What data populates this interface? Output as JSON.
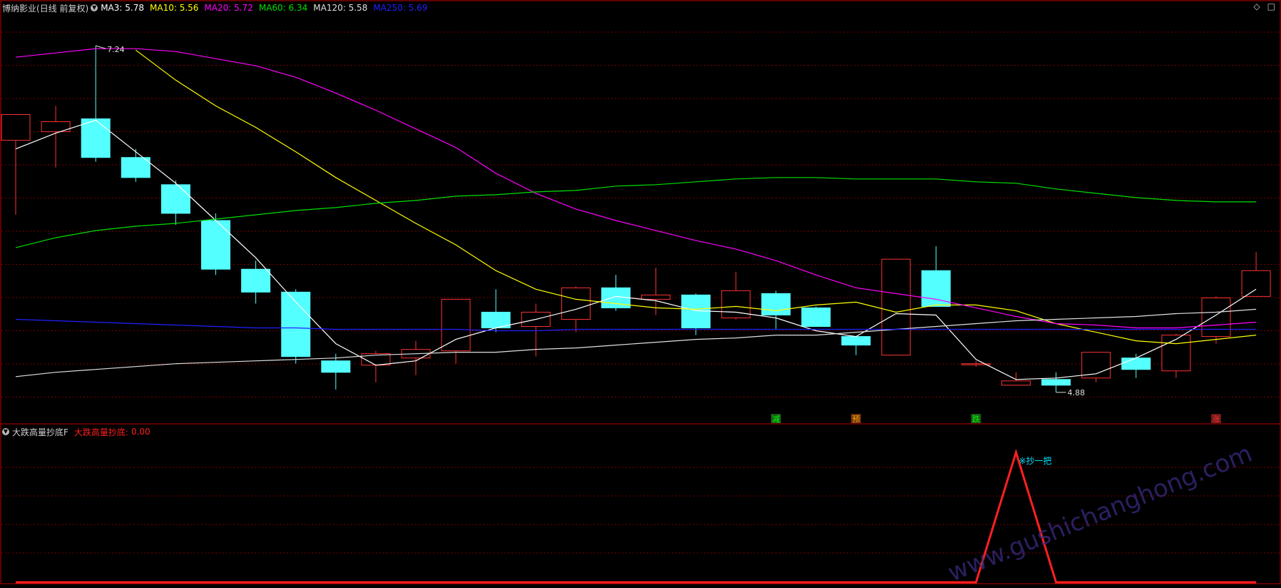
{
  "main_panel": {
    "stock_name": "博纳影业",
    "period_info": "(日线 前复权)",
    "ma_legend": [
      {
        "label": "MA3:",
        "value": "5.78",
        "color": "#ffffff"
      },
      {
        "label": "MA10:",
        "value": "5.56",
        "color": "#ffff00"
      },
      {
        "label": "MA20:",
        "value": "5.72",
        "color": "#ff00ff"
      },
      {
        "label": "MA60:",
        "value": "6.34",
        "color": "#00e000"
      },
      {
        "label": "MA120:",
        "value": "5.58",
        "color": "#e0e0e0"
      },
      {
        "label": "MA250:",
        "value": "5.69",
        "color": "#2020ff"
      }
    ],
    "high_label": "7.24",
    "low_label": "4.88",
    "signals": [
      {
        "index": 19,
        "text": "减",
        "color": "#00ff00",
        "bg": "#1a5a1a"
      },
      {
        "index": 21,
        "text": "预",
        "color": "#ffaa00",
        "bg": "#6a3010"
      },
      {
        "index": 24,
        "text": "跌",
        "color": "#00ff00",
        "bg": "#1a5a1a"
      },
      {
        "index": 30,
        "text": "涨",
        "color": "#ff3030",
        "bg": "#6a1a1a"
      }
    ]
  },
  "sub_panel": {
    "indicator_name": "大跌高量抄底F",
    "series_label": "大跌高量抄底:",
    "series_value": "0.00",
    "annotation": "※抄一把",
    "colors": {
      "line": "#ff2020",
      "label": "#ff2020",
      "annotation": "#00e5ff"
    }
  },
  "watermark": "www.gushichanghong.com",
  "colors": {
    "up": "#ff3232",
    "down": "#54ffff",
    "grid": "#7a0000",
    "border": "#c00000"
  },
  "chart_data": [
    {
      "type": "candlestick",
      "ylim": [
        4.6,
        7.45
      ],
      "candles": [
        {
          "o": 6.58,
          "h": 6.66,
          "l": 6.06,
          "c": 6.76
        },
        {
          "o": 6.64,
          "h": 6.82,
          "l": 6.39,
          "c": 6.71
        },
        {
          "o": 6.73,
          "h": 7.24,
          "l": 6.43,
          "c": 6.46
        },
        {
          "o": 6.46,
          "h": 6.52,
          "l": 6.29,
          "c": 6.32
        },
        {
          "o": 6.27,
          "h": 6.3,
          "l": 5.99,
          "c": 6.07
        },
        {
          "o": 6.02,
          "h": 6.07,
          "l": 5.64,
          "c": 5.68
        },
        {
          "o": 5.68,
          "h": 5.74,
          "l": 5.44,
          "c": 5.52
        },
        {
          "o": 5.52,
          "h": 5.54,
          "l": 5.02,
          "c": 5.07
        },
        {
          "o": 5.04,
          "h": 5.09,
          "l": 4.84,
          "c": 4.96
        },
        {
          "o": 5.01,
          "h": 5.11,
          "l": 4.89,
          "c": 5.09
        },
        {
          "o": 5.06,
          "h": 5.18,
          "l": 4.94,
          "c": 5.12
        },
        {
          "o": 5.11,
          "h": 5.47,
          "l": 5.02,
          "c": 5.47
        },
        {
          "o": 5.38,
          "h": 5.54,
          "l": 5.24,
          "c": 5.27
        },
        {
          "o": 5.28,
          "h": 5.44,
          "l": 5.07,
          "c": 5.38
        },
        {
          "o": 5.33,
          "h": 5.56,
          "l": 5.24,
          "c": 5.55
        },
        {
          "o": 5.55,
          "h": 5.64,
          "l": 5.39,
          "c": 5.41
        },
        {
          "o": 5.47,
          "h": 5.69,
          "l": 5.36,
          "c": 5.5
        },
        {
          "o": 5.5,
          "h": 5.51,
          "l": 5.22,
          "c": 5.27
        },
        {
          "o": 5.34,
          "h": 5.66,
          "l": 5.33,
          "c": 5.53
        },
        {
          "o": 5.51,
          "h": 5.53,
          "l": 5.26,
          "c": 5.36
        },
        {
          "o": 5.41,
          "h": 5.42,
          "l": 5.28,
          "c": 5.28
        },
        {
          "o": 5.21,
          "h": 5.2,
          "l": 5.08,
          "c": 5.15
        },
        {
          "o": 5.08,
          "h": 5.7,
          "l": 5.08,
          "c": 5.75
        },
        {
          "o": 5.67,
          "h": 5.84,
          "l": 5.42,
          "c": 5.42
        },
        {
          "o": 5.02,
          "h": 5.04,
          "l": 5.0,
          "c": 5.02
        },
        {
          "o": 4.87,
          "h": 4.96,
          "l": 4.88,
          "c": 4.9
        },
        {
          "o": 4.91,
          "h": 4.96,
          "l": 4.82,
          "c": 4.87
        },
        {
          "o": 4.92,
          "h": 5.02,
          "l": 4.89,
          "c": 5.1
        },
        {
          "o": 5.06,
          "h": 5.09,
          "l": 4.92,
          "c": 4.98
        },
        {
          "o": 4.97,
          "h": 5.23,
          "l": 4.92,
          "c": 5.22
        },
        {
          "o": 5.21,
          "h": 5.49,
          "l": 5.16,
          "c": 5.48
        },
        {
          "o": 5.49,
          "h": 5.8,
          "l": 5.53,
          "c": 5.67
        }
      ],
      "series": [
        {
          "name": "MA3",
          "values": [
            6.52,
            6.63,
            6.72,
            6.5,
            6.28,
            6.02,
            5.76,
            5.45,
            5.16,
            5.01,
            5.04,
            5.19,
            5.27,
            5.33,
            5.4,
            5.49,
            5.46,
            5.39,
            5.38,
            5.34,
            5.25,
            5.21,
            5.37,
            5.36,
            5.05,
            4.91,
            4.92,
            4.95,
            5.06,
            5.19,
            5.36,
            5.54
          ]
        },
        {
          "name": "MA10",
          "values": [
            null,
            null,
            null,
            7.21,
            7.0,
            6.82,
            6.67,
            6.5,
            6.32,
            6.16,
            6.0,
            5.85,
            5.67,
            5.54,
            5.47,
            5.44,
            5.41,
            5.4,
            5.42,
            5.39,
            5.43,
            5.45,
            5.38,
            5.43,
            5.43,
            5.39,
            5.3,
            5.24,
            5.18,
            5.16,
            5.19,
            5.22
          ]
        },
        {
          "name": "MA20",
          "values": [
            7.16,
            7.19,
            7.22,
            7.22,
            7.2,
            7.15,
            7.1,
            7.02,
            6.91,
            6.79,
            6.66,
            6.53,
            6.35,
            6.21,
            6.1,
            6.02,
            5.95,
            5.88,
            5.82,
            5.74,
            5.64,
            5.55,
            5.51,
            5.47,
            5.41,
            5.35,
            5.3,
            5.29,
            5.27,
            5.27,
            5.29,
            5.31
          ]
        },
        {
          "name": "MA60",
          "values": [
            5.83,
            5.9,
            5.95,
            5.98,
            6.0,
            6.03,
            6.06,
            6.09,
            6.11,
            6.14,
            6.16,
            6.19,
            6.2,
            6.22,
            6.23,
            6.26,
            6.27,
            6.29,
            6.31,
            6.32,
            6.32,
            6.31,
            6.31,
            6.31,
            6.29,
            6.28,
            6.24,
            6.21,
            6.18,
            6.16,
            6.15,
            6.15
          ]
        },
        {
          "name": "MA120",
          "values": [
            4.93,
            4.96,
            4.98,
            5.0,
            5.02,
            5.03,
            5.04,
            5.05,
            5.06,
            5.08,
            5.09,
            5.1,
            5.1,
            5.12,
            5.13,
            5.15,
            5.17,
            5.19,
            5.2,
            5.22,
            5.22,
            5.24,
            5.26,
            5.28,
            5.3,
            5.32,
            5.33,
            5.34,
            5.35,
            5.37,
            5.38,
            5.4
          ]
        },
        {
          "name": "MA250",
          "values": [
            5.33,
            5.32,
            5.31,
            5.3,
            5.29,
            5.28,
            5.27,
            5.27,
            5.26,
            5.26,
            5.26,
            5.26,
            5.25,
            5.25,
            5.26,
            5.26,
            5.26,
            5.26,
            5.26,
            5.26,
            5.26,
            5.26,
            5.26,
            5.26,
            5.26,
            5.26,
            5.26,
            5.26,
            5.26,
            5.26,
            5.26,
            5.26
          ]
        }
      ]
    },
    {
      "type": "line",
      "ylim": [
        0,
        1.0
      ],
      "series": [
        {
          "name": "大跌高量抄底",
          "points": [
            [
              0,
              0
            ],
            [
              24,
              0
            ],
            [
              25,
              1
            ],
            [
              26,
              0
            ],
            [
              31,
              0
            ]
          ]
        }
      ]
    }
  ]
}
